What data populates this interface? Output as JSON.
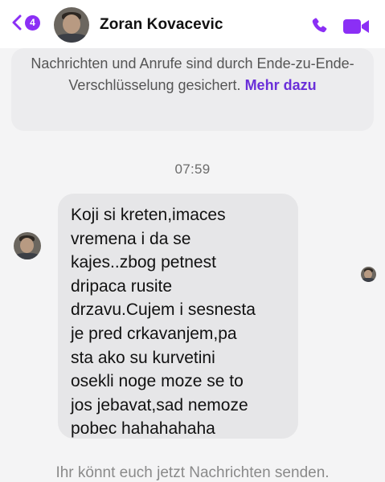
{
  "header": {
    "back_badge_count": "4",
    "contact_name": "Zoran Kovacevic",
    "icons": {
      "back": "chevron-left-icon",
      "call": "phone-icon",
      "video": "video-camera-icon"
    },
    "accent_color": "#8b2ff5"
  },
  "encryption_notice": {
    "text": "Nachrichten und Anrufe sind durch Ende-zu-Ende-Verschlüsselung gesichert.",
    "link_label": "Mehr dazu"
  },
  "conversation": {
    "timestamp": "07:59",
    "messages": [
      {
        "sender": "Zoran Kovacevic",
        "text": "Koji si kreten,imaces\nvremena i da se\nkajes..zbog petnest\ndripaca rusite\ndrzavu.Cujem i sesnesta\nje pred crkavanjem,pa\nsta ako su kurvetini\nosekli noge moze se to\njos jebavat,sad nemoze\npobec hahahahaha"
      }
    ]
  },
  "footer": {
    "note": "Ihr könnt euch jetzt Nachrichten senden."
  }
}
